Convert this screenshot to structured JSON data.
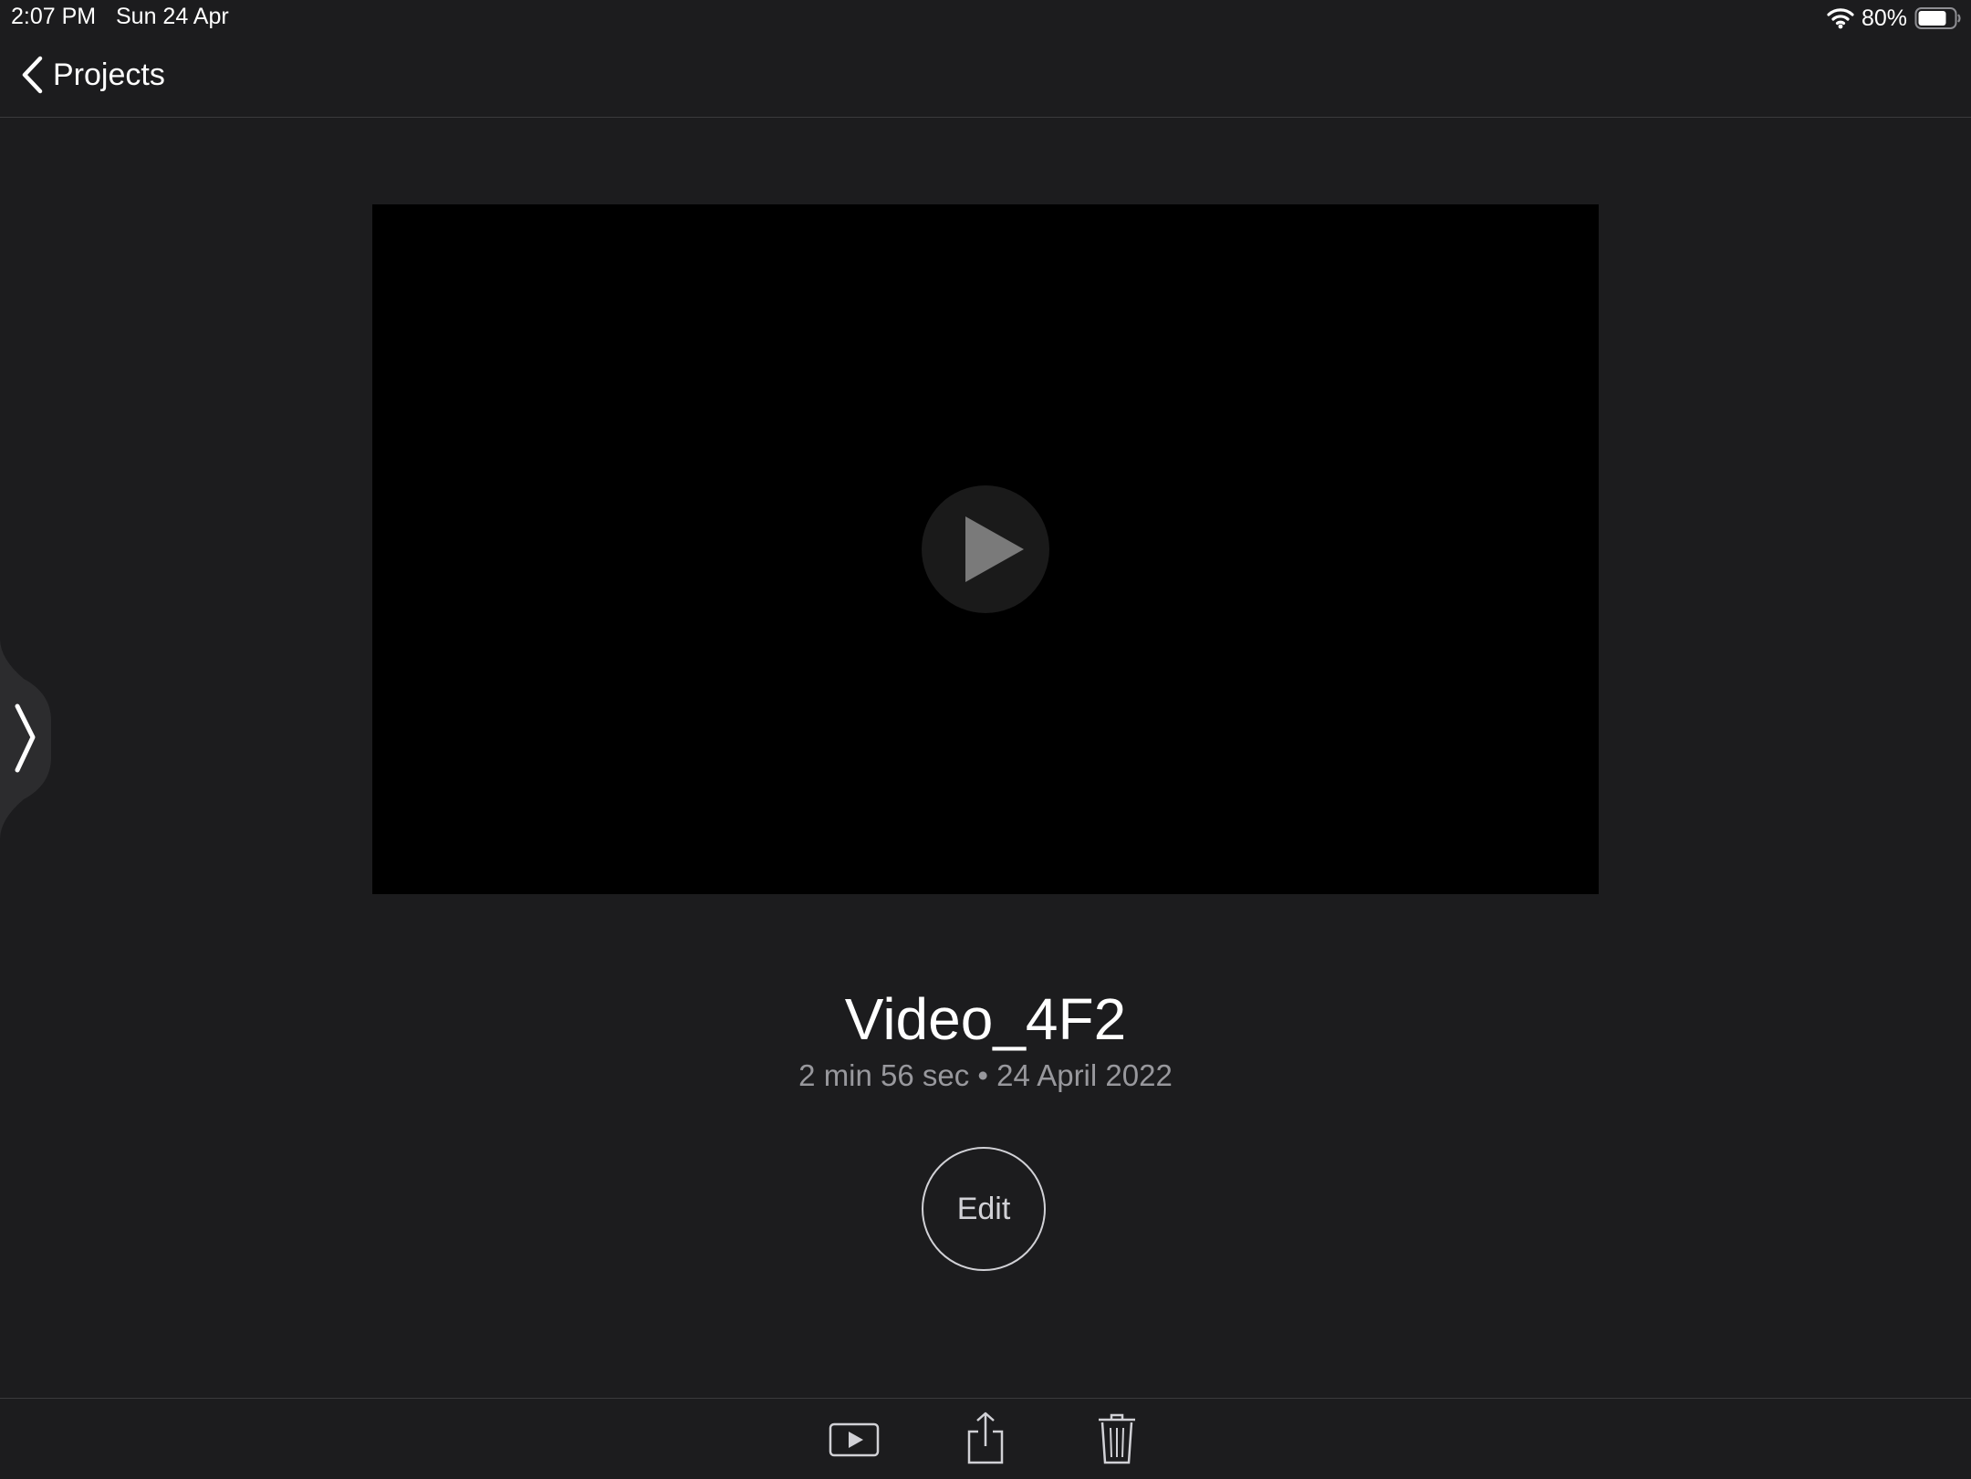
{
  "status_bar": {
    "time": "2:07 PM",
    "date": "Sun 24 Apr",
    "battery_percent": "80%",
    "battery_level": 0.8,
    "wifi_icon": "wifi-icon",
    "battery_icon": "battery-icon"
  },
  "nav": {
    "back_label": "Projects",
    "back_icon": "chevron-left-icon"
  },
  "sidebar": {
    "toggle_icon": "chevron-right-icon"
  },
  "video": {
    "play_icon": "play-icon"
  },
  "project": {
    "title": "Video_4F2",
    "meta": "2 min 56 sec • 24 April 2022"
  },
  "actions": {
    "edit_label": "Edit"
  },
  "toolbar": {
    "icons": [
      "play-theater-icon",
      "share-icon",
      "trash-icon"
    ]
  },
  "colors": {
    "background": "#1c1c1e",
    "video_background": "#000000",
    "secondary_text": "#98989d",
    "divider": "#3a3a3c"
  }
}
